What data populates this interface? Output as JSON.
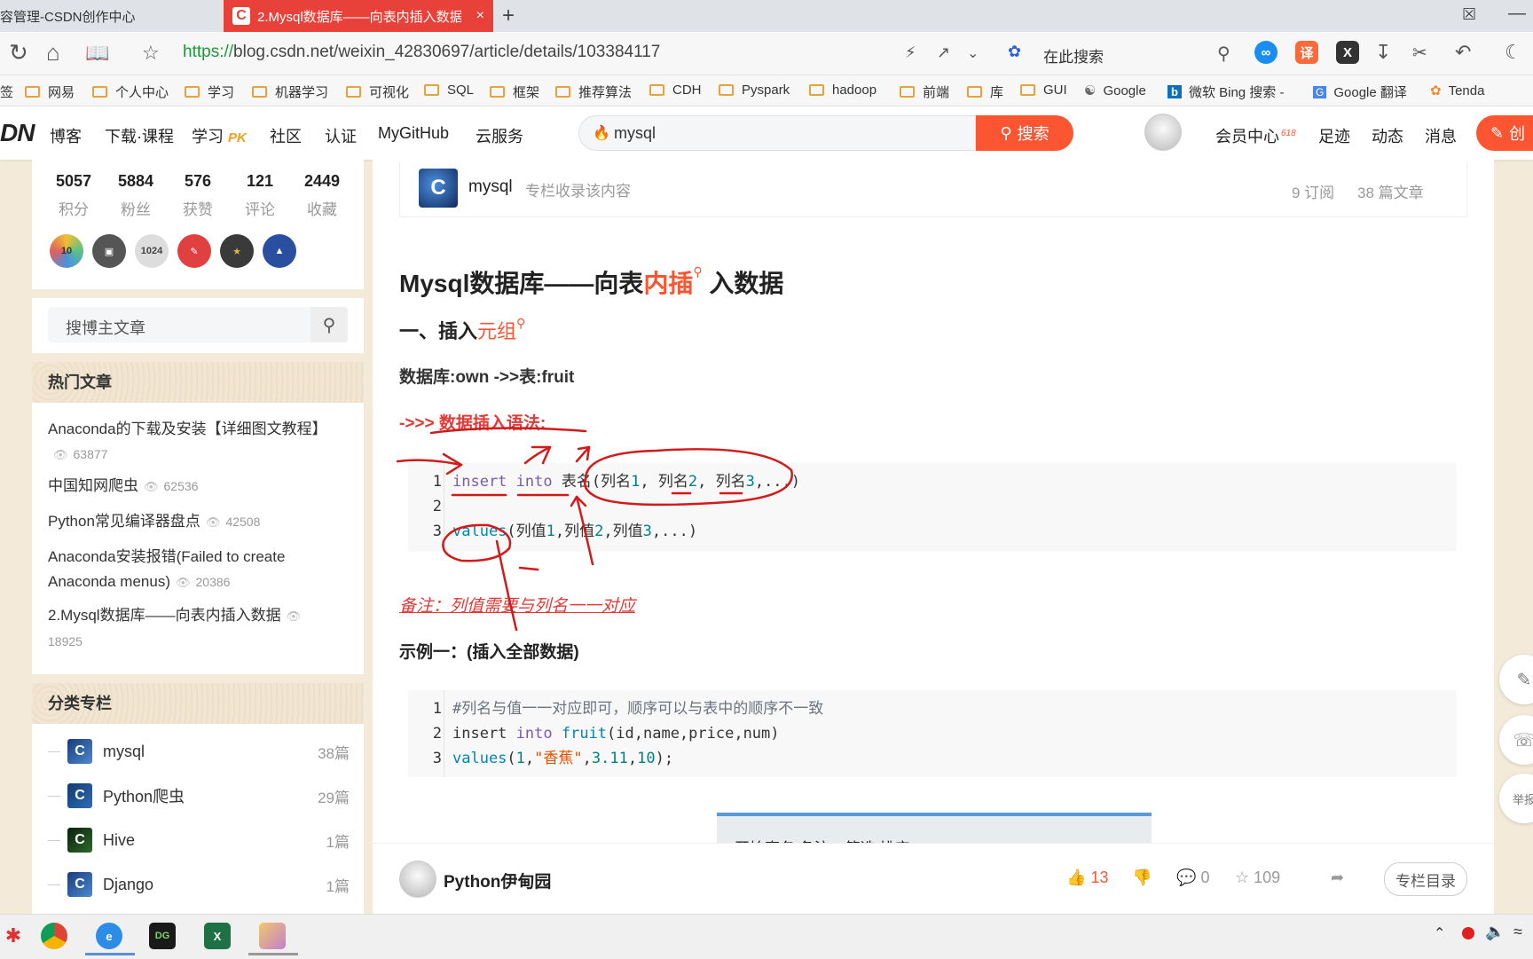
{
  "browser": {
    "tabs": [
      {
        "label": "容管理-CSDN创作中心"
      },
      {
        "label": "2.Mysql数据库——向表内插入数据"
      }
    ],
    "tab_logo": "C",
    "tab_close": "×",
    "new_tab": "+",
    "url_scheme": "https://",
    "url_rest": "blog.csdn.net/weixin_42830697/article/details/103384117",
    "search_placeholder": "在此搜索",
    "translate_icon_label": "译"
  },
  "bookmarks": [
    {
      "label": "网易"
    },
    {
      "label": "个人中心"
    },
    {
      "label": "学习"
    },
    {
      "label": "机器学习"
    },
    {
      "label": "可视化"
    },
    {
      "label": "SQL"
    },
    {
      "label": "框架"
    },
    {
      "label": "推荐算法"
    },
    {
      "label": "CDH"
    },
    {
      "label": "Pyspark"
    },
    {
      "label": "hadoop"
    },
    {
      "label": "前端"
    },
    {
      "label": "库"
    },
    {
      "label": "GUI"
    },
    {
      "label": "Google"
    },
    {
      "label": "微软 Bing 搜索 -"
    },
    {
      "label": "Google 翻译"
    },
    {
      "label": "Tenda"
    }
  ],
  "csdn_header": {
    "logo": "DN",
    "nav": [
      "博客",
      "下载·课程",
      "学习",
      "社区",
      "认证",
      "MyGitHub",
      "云服务"
    ],
    "pk_badge": "PK",
    "search_value": "mysql",
    "search_button": "搜索",
    "right_nav": [
      "会员中心",
      "足迹",
      "动态",
      "消息"
    ],
    "vip_badge": "618",
    "create_button": "创"
  },
  "profile_stats": [
    {
      "value": "5057",
      "label": "积分"
    },
    {
      "value": "5884",
      "label": "粉丝"
    },
    {
      "value": "576",
      "label": "获赞"
    },
    {
      "value": "121",
      "label": "评论"
    },
    {
      "value": "2449",
      "label": "收藏"
    }
  ],
  "badges": [
    "10",
    "",
    "1024",
    "",
    "",
    ""
  ],
  "sidebar_search": {
    "placeholder": "搜博主文章"
  },
  "hot_articles": {
    "heading": "热门文章",
    "items": [
      {
        "title": "Anaconda的下载及安装【详细图文教程】",
        "views": "63877"
      },
      {
        "title": "中国知网爬虫",
        "views": "62536"
      },
      {
        "title": "Python常见编译器盘点",
        "views": "42508"
      },
      {
        "title": "Anaconda安装报错(Failed to create Anaconda menus)",
        "views": "20386"
      },
      {
        "title": "2.Mysql数据库——向表内插入数据",
        "views": "18925"
      }
    ]
  },
  "columns": {
    "heading": "分类专栏",
    "items": [
      {
        "name": "mysql",
        "count": "38篇"
      },
      {
        "name": "Python爬虫",
        "count": "29篇"
      },
      {
        "name": "Hive",
        "count": "1篇"
      },
      {
        "name": "Django",
        "count": "1篇"
      }
    ]
  },
  "column_box": {
    "name": "mysql",
    "desc": "专栏收录该内容",
    "subs": "9 订阅",
    "articles": "38 篇文章"
  },
  "article": {
    "title_a": "Mysql数据库——向表",
    "title_kw": "内插",
    "title_b": "入数据",
    "sec1_a": "一、插入",
    "sec1_kw": "元组",
    "db_line": "数据库:own ->>表:fruit",
    "syntax_heading": "->>> 数据插入语法:",
    "code1": [
      {
        "n": "1",
        "text": "insert into 表名(列名1, 列名2, 列名3,...)"
      },
      {
        "n": "2",
        "text": ""
      },
      {
        "n": "3",
        "text": "values(列值1,列值2,列值3,...)"
      }
    ],
    "note": "备注：列值需要与列名一一对应",
    "example1": "示例一：(插入全部数据)",
    "code2": [
      {
        "n": "1",
        "text": "#列名与值一一对应即可，顺序可以与表中的顺序不一致"
      },
      {
        "n": "2",
        "text": "insert into fruit(id,name,price,num)"
      },
      {
        "n": "3",
        "text": "values(1,\"香蕉\",3.11,10);"
      }
    ],
    "embedded_image_text": "开始事务   备注 ▾  筛选   排序"
  },
  "action_bar": {
    "author": "Python伊甸园",
    "likes": "13",
    "comments": "0",
    "favorites": "109",
    "toc": "专栏目录"
  },
  "float_tools": {
    "report": "举报"
  },
  "colors": {
    "accent": "#fc5531",
    "tab_active": "#e8413a",
    "annotation": "#d31a1a"
  }
}
